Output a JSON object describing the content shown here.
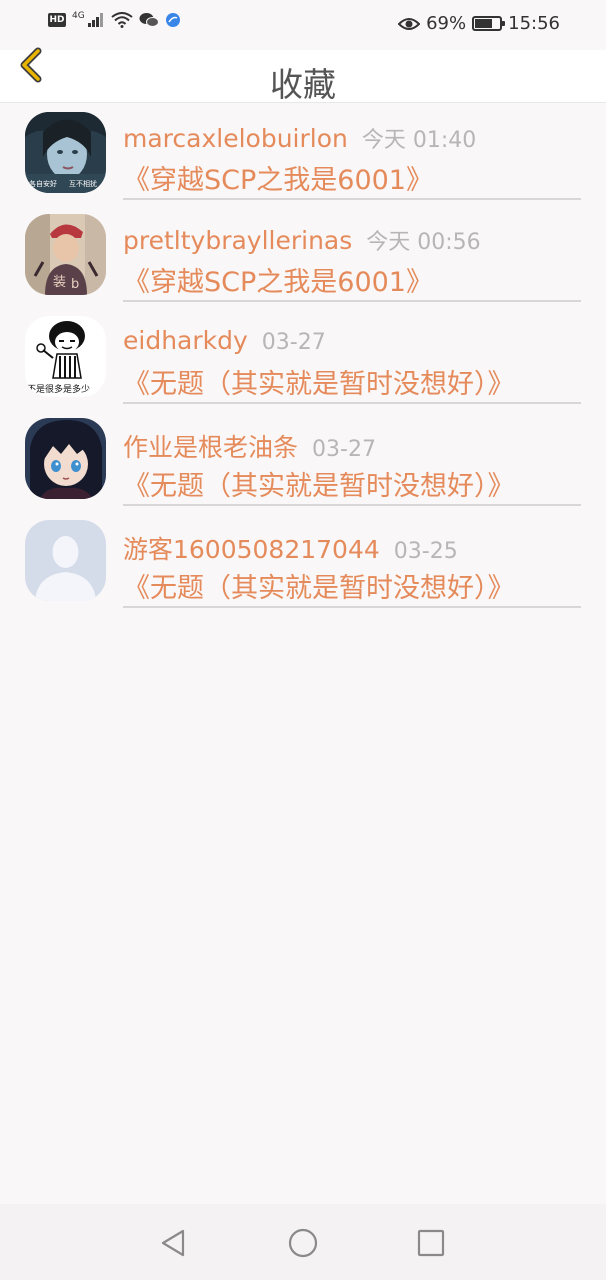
{
  "status_bar": {
    "network": "4G",
    "hd": "HD",
    "battery_percent": "69%",
    "battery_level": 0.69,
    "time": "15:56",
    "icons": [
      "hd-icon",
      "signal-icon",
      "wifi-icon",
      "wechat-icon",
      "browser-icon",
      "eye-icon",
      "battery-icon"
    ]
  },
  "header": {
    "title": "收藏",
    "back_icon": "chevron-left-icon"
  },
  "favorites": [
    {
      "user": "marcaxlelobuirlon",
      "time": "今天 01:40",
      "book": "《穿越SCP之我是6001》"
    },
    {
      "user": "pretltybrayllerinas",
      "time": "今天 00:56",
      "book": "《穿越SCP之我是6001》"
    },
    {
      "user": "eidharkdy",
      "time": "03-27",
      "book": "《无题（其实就是暂时没想好）》"
    },
    {
      "user": "作业是根老油条",
      "time": "03-27",
      "book": "《无题（其实就是暂时没想好）》"
    },
    {
      "user": "游客1600508217044",
      "time": "03-25",
      "book": "《无题（其实就是暂时没想好）》"
    }
  ],
  "avatar_texts": {
    "a1_top_left": "各自安好",
    "a1_top_right": "互不相扰",
    "a3_caption": "不是很多是多少"
  },
  "nav_bar": {
    "icons": [
      "back-triangle-icon",
      "home-circle-icon",
      "recents-square-icon"
    ]
  },
  "colors": {
    "accent": "#e58b5b",
    "back_icon": "#e8b400",
    "time": "#b6b6b6"
  }
}
